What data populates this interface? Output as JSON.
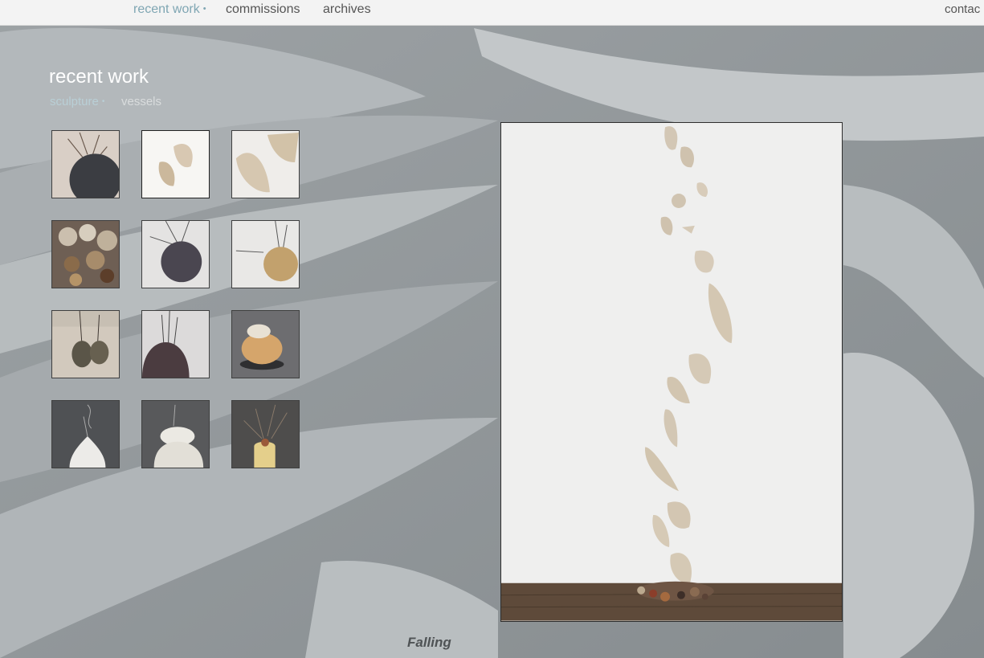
{
  "nav": {
    "items": [
      {
        "label": "recent work",
        "active": true
      },
      {
        "label": "commissions",
        "active": false
      },
      {
        "label": "archives",
        "active": false
      }
    ],
    "right_label": "contac",
    "active_color": "#7fa6b3",
    "dot": "•"
  },
  "page": {
    "title": "recent work",
    "subnav": [
      {
        "label": "sculpture",
        "active": true
      },
      {
        "label": "vessels",
        "active": false
      }
    ]
  },
  "gallery": {
    "thumbnails": [
      {
        "subject": "dark sphere with wire branches"
      },
      {
        "subject": "pale curled fragments"
      },
      {
        "subject": "pale ribbed fragments"
      },
      {
        "subject": "pile of stones and shells"
      },
      {
        "subject": "dark sphere hanging on wire"
      },
      {
        "subject": "tan sphere hanging on wire"
      },
      {
        "subject": "hanging dark fragments"
      },
      {
        "subject": "dark dome with wire stems"
      },
      {
        "subject": "stacked stones on dark base"
      },
      {
        "subject": "white ribbed vessel with wire"
      },
      {
        "subject": "stacked white ribbed forms"
      },
      {
        "subject": "yellow vessel with wire stems"
      }
    ],
    "selected_index": 1
  },
  "main_image": {
    "subject": "Falling pale ceramic fragments on white wall"
  },
  "caption": "Falling"
}
